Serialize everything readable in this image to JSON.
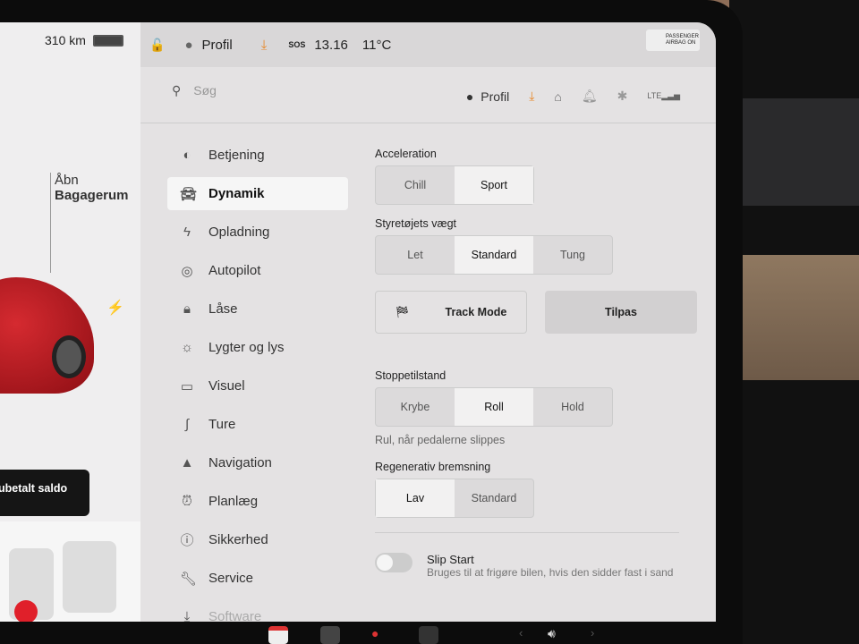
{
  "status": {
    "range": "310 km",
    "profile": "Profil",
    "time": "13.16",
    "temp": "11°C",
    "sos": "SOS",
    "airbag_line1": "PASSENGER",
    "airbag_line2": "AIRBAG ON"
  },
  "left": {
    "trunk_line1": "Åbn",
    "trunk_line2": "Bagagerum",
    "balance": "ubetalt saldo"
  },
  "header": {
    "search_placeholder": "Søg",
    "profile": "Profil"
  },
  "nav": [
    {
      "label": "Betjening",
      "icon": "toggle-icon"
    },
    {
      "label": "Dynamik",
      "icon": "car-icon",
      "active": true
    },
    {
      "label": "Opladning",
      "icon": "bolt-icon"
    },
    {
      "label": "Autopilot",
      "icon": "steering-wheel-icon"
    },
    {
      "label": "Låse",
      "icon": "lock-icon"
    },
    {
      "label": "Lygter og lys",
      "icon": "light-icon"
    },
    {
      "label": "Visuel",
      "icon": "display-icon"
    },
    {
      "label": "Ture",
      "icon": "trips-icon"
    },
    {
      "label": "Navigation",
      "icon": "navigation-icon"
    },
    {
      "label": "Planlæg",
      "icon": "alarm-clock-icon"
    },
    {
      "label": "Sikkerhed",
      "icon": "info-icon"
    },
    {
      "label": "Service",
      "icon": "wrench-icon"
    },
    {
      "label": "Software",
      "icon": "download-icon"
    }
  ],
  "settings": {
    "acceleration": {
      "label": "Acceleration",
      "options": [
        "Chill",
        "Sport"
      ],
      "selected": "Sport"
    },
    "steering": {
      "label": "Styretøjets vægt",
      "options": [
        "Let",
        "Standard",
        "Tung"
      ],
      "selected": "Standard"
    },
    "track_mode": "Track Mode",
    "customize": "Tilpas",
    "stopping": {
      "label": "Stoppetilstand",
      "options": [
        "Krybe",
        "Roll",
        "Hold"
      ],
      "selected": "Roll",
      "description": "Rul, når pedalerne slippes"
    },
    "regen": {
      "label": "Regenerativ bremsning",
      "options": [
        "Lav",
        "Standard"
      ],
      "selected": "Lav"
    },
    "slip_start": {
      "label": "Slip Start",
      "description": "Bruges til at frigøre bilen, hvis den sidder fast i sand",
      "on": false
    }
  },
  "colors": {
    "accent": "#e8892b",
    "car": "#c0141c"
  }
}
